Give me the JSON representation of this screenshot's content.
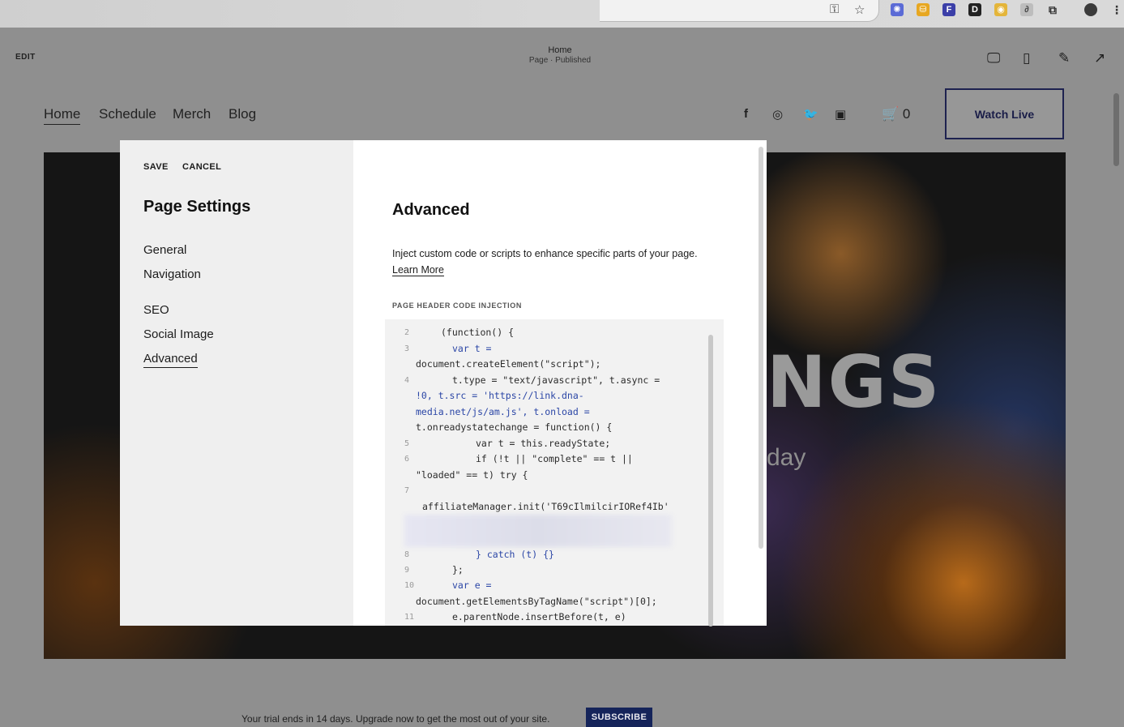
{
  "browser": {
    "extensions": [
      "key-icon",
      "star-icon",
      "ext-1",
      "ext-2",
      "ext-3",
      "ext-4",
      "ext-5",
      "ext-6",
      "puzzle-icon",
      "profile-avatar",
      "menu-dots"
    ]
  },
  "editor": {
    "edit_label": "EDIT",
    "page_title": "Home",
    "page_status": "Page · Published"
  },
  "site": {
    "nav": [
      "Home",
      "Schedule",
      "Merch",
      "Blog"
    ],
    "cart_count": "0",
    "watch_live": "Watch Live",
    "hero_word": "NGS",
    "hero_sub": "day"
  },
  "trial": {
    "text": "Your trial ends in 14 days. Upgrade now to get the most out of your site.",
    "subscribe": "SUBSCRIBE"
  },
  "modal": {
    "save": "SAVE",
    "cancel": "CANCEL",
    "title": "Page Settings",
    "items": [
      "General",
      "Navigation",
      "SEO",
      "Social Image",
      "Advanced"
    ],
    "panel_title": "Advanced",
    "desc": "Inject custom code or scripts to enhance specific parts of your page.",
    "learn_more": "Learn More",
    "injection_label": "PAGE HEADER CODE INJECTION",
    "code": {
      "l2": "(function() {",
      "l3a": "var t =",
      "l3b": "document.createElement(\"script\");",
      "l4a": "t.type = \"text/javascript\", t.async =",
      "l4b": "!0, t.src = 'https://link.dna-",
      "l4c": "media.net/js/am.js', t.onload =",
      "l4d": "t.onreadystatechange = function() {",
      "l5": "var t = this.readyState;",
      "l6a": "if (!t || \"complete\" == t ||",
      "l6b": "\"loaded\" == t) try {",
      "l7": "affiliateManager.init('T69cIlmilcirIORef4Ib'",
      "l8": "} catch (t) {}",
      "l9": "};",
      "l10a": "var e =",
      "l10b": "document.getElementsByTagName(\"script\")[0];",
      "l11": "e.parentNode.insertBefore(t, e)"
    },
    "line_numbers": [
      "2",
      "3",
      "4",
      "5",
      "6",
      "7",
      "8",
      "9",
      "10",
      "11"
    ]
  },
  "colors": {
    "overlay": "#8f8f8f",
    "brand_navy": "#15245a",
    "code_keyword": "#2b46a6"
  }
}
